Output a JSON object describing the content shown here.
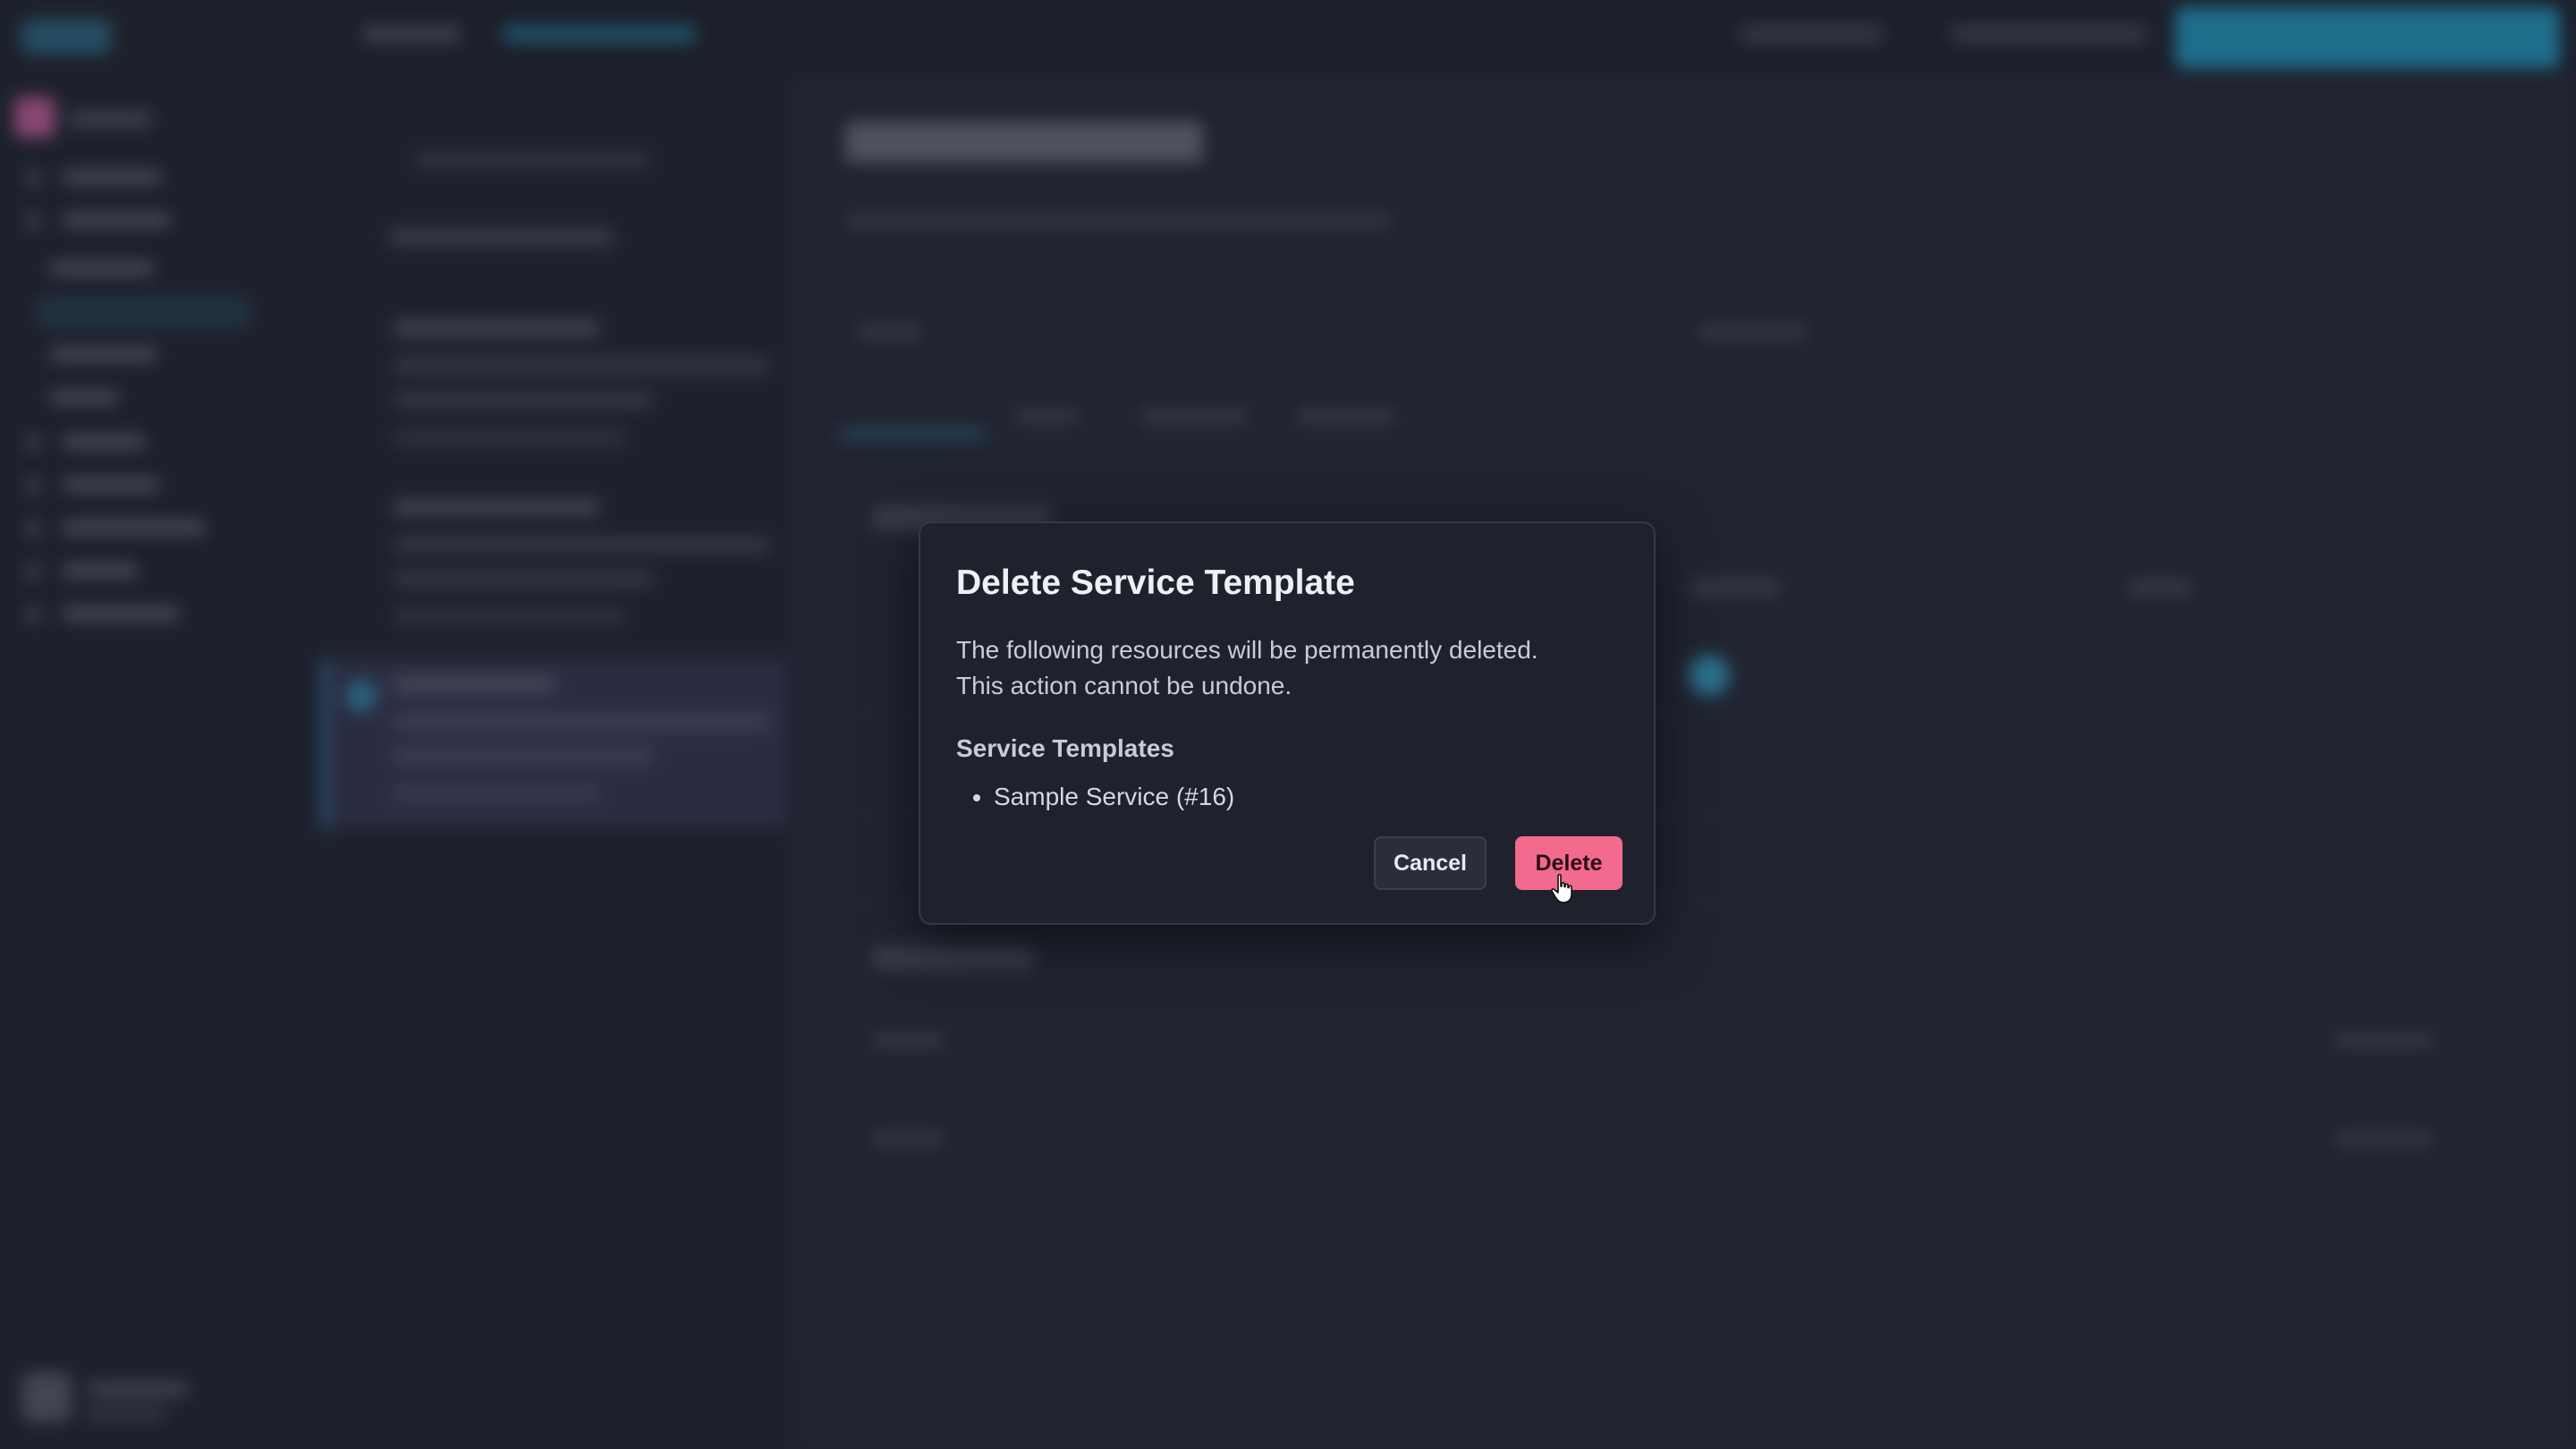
{
  "dialog": {
    "title": "Delete Service Template",
    "description_line1": "The following resources will be permanently deleted.",
    "description_line2": "This action cannot be undone.",
    "section_heading": "Service Templates",
    "resources": [
      "Sample Service (#16)"
    ],
    "cancel_label": "Cancel",
    "delete_label": "Delete"
  },
  "colors": {
    "accent": "#29b6e6",
    "danger": "#f26a8d",
    "dialog_bg": "#1f222d"
  },
  "icons": {
    "cursor": "hand-pointer-icon"
  }
}
